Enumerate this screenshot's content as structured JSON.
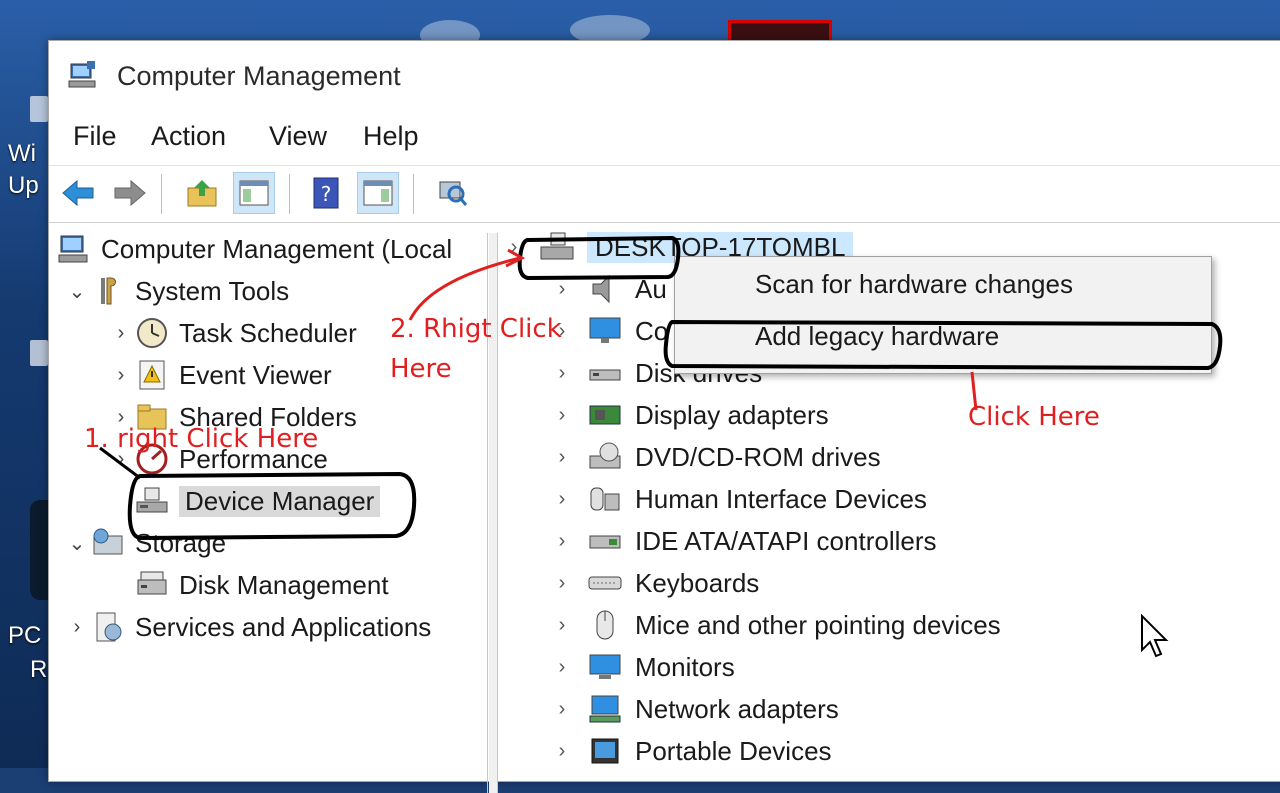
{
  "window": {
    "title": "Computer Management",
    "menu": [
      "File",
      "Action",
      "View",
      "Help"
    ]
  },
  "toolbar": {
    "buttons": [
      "back-icon",
      "forward-icon",
      "up-folder-icon",
      "show-hide-tree-icon",
      "help-icon",
      "show-hide-action-pane-icon",
      "properties-icon"
    ]
  },
  "left_tree": {
    "root": "Computer Management (Local",
    "system_tools": "System Tools",
    "task_scheduler": "Task Scheduler",
    "event_viewer": "Event Viewer",
    "shared_folders": "Shared Folders",
    "performance": "Performance",
    "device_manager": "Device Manager",
    "storage": "Storage",
    "disk_management": "Disk Management",
    "services": "Services and Applications"
  },
  "right_tree": {
    "root": "DESKTOP-17TOMBL",
    "items": [
      "Au",
      "Co",
      "Disk drives",
      "Display adapters",
      "DVD/CD-ROM drives",
      "Human Interface Devices",
      "IDE ATA/ATAPI controllers",
      "Keyboards",
      "Mice and other pointing devices",
      "Monitors",
      "Network adapters",
      "Portable Devices"
    ]
  },
  "context_menu": {
    "scan": "Scan for hardware changes",
    "add_legacy": "Add legacy hardware"
  },
  "annotations": {
    "step1": "1. right Click Here",
    "step2_line1": "2. Rhigt Click",
    "step2_line2": "Here",
    "click_here": "Click Here"
  },
  "desktop": {
    "labels": [
      "Wi",
      "Up",
      "PC",
      "R"
    ]
  },
  "colors": {
    "annotation": "#e02020",
    "selection": "#cce8ff",
    "active_toolbar": "#cfe5f8"
  }
}
